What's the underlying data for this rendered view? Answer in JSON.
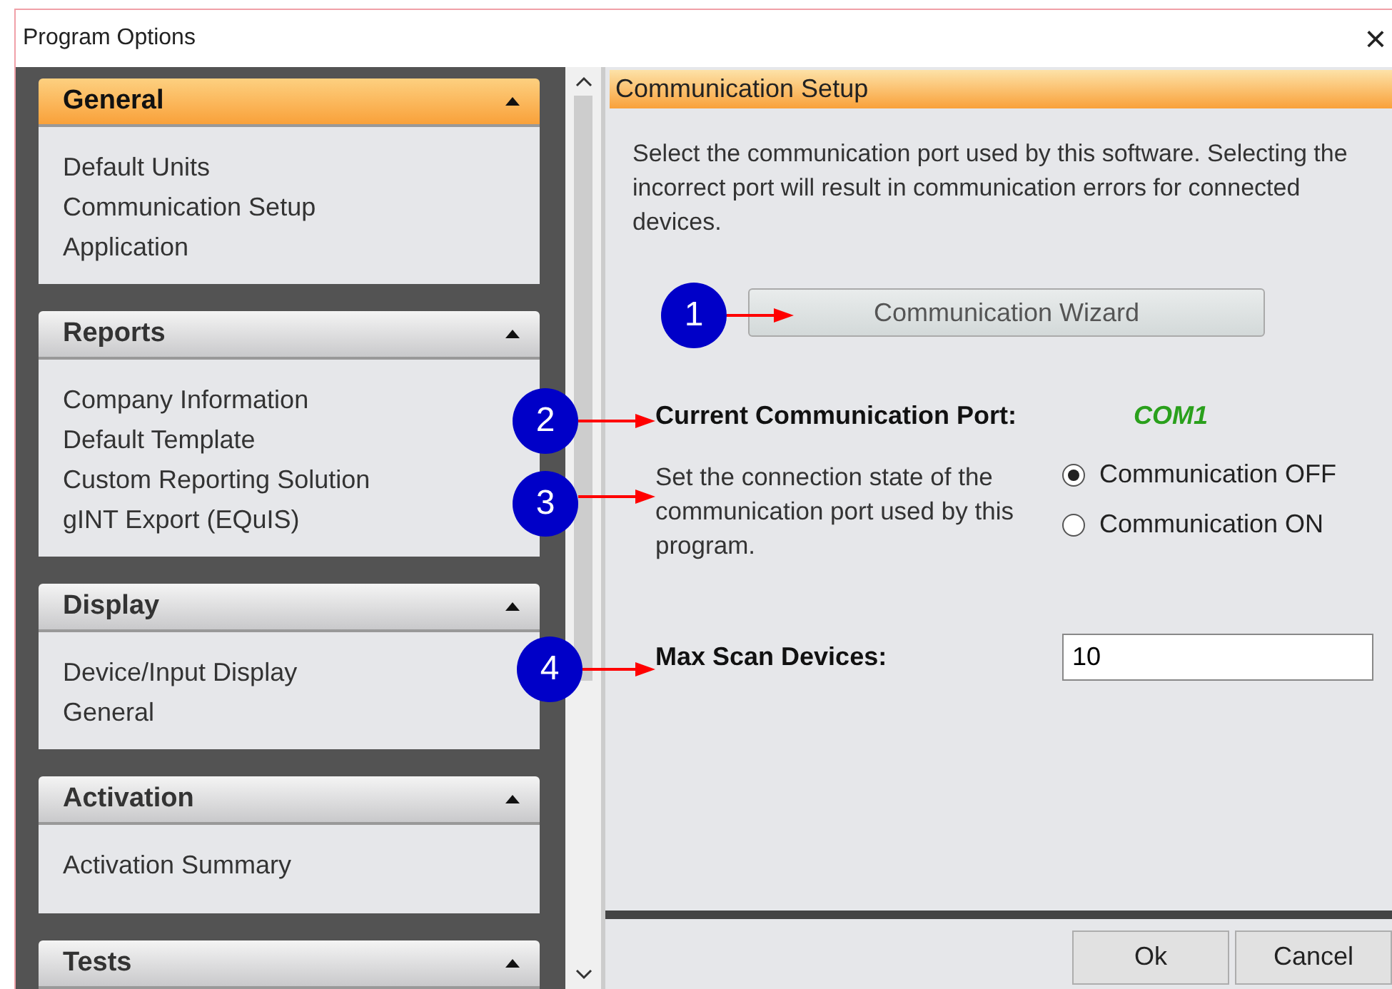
{
  "window": {
    "title": "Program Options",
    "close": "×"
  },
  "sidebar": {
    "sections": [
      {
        "title": "General",
        "selected": true,
        "items": [
          "Default Units",
          "Communication Setup",
          "Application"
        ]
      },
      {
        "title": "Reports",
        "selected": false,
        "items": [
          "Company Information",
          "Default Template",
          "Custom Reporting Solution",
          "gINT Export (EQuIS)"
        ]
      },
      {
        "title": "Display",
        "selected": false,
        "items": [
          "Device/Input Display",
          "General"
        ]
      },
      {
        "title": "Activation",
        "selected": false,
        "items": [
          "Activation Summary"
        ]
      },
      {
        "title": "Tests",
        "selected": false
      }
    ]
  },
  "panel": {
    "title": "Communication Setup",
    "description": "Select the communication port used by this software. Selecting the incorrect port will result in communication errors for connected devices.",
    "wizard_button": "Communication Wizard",
    "port_label": "Current Communication Port:",
    "port_value": "COM1",
    "state_text": "Set the connection state of the communication port used by this program.",
    "state_options": [
      {
        "label": "Communication OFF",
        "selected": true
      },
      {
        "label": "Communication ON",
        "selected": false
      }
    ],
    "max_scan_label": "Max Scan Devices:",
    "max_scan_value": "10"
  },
  "callouts": [
    "1",
    "2",
    "3",
    "4"
  ],
  "buttons": [
    "Ok",
    "Cancel"
  ]
}
